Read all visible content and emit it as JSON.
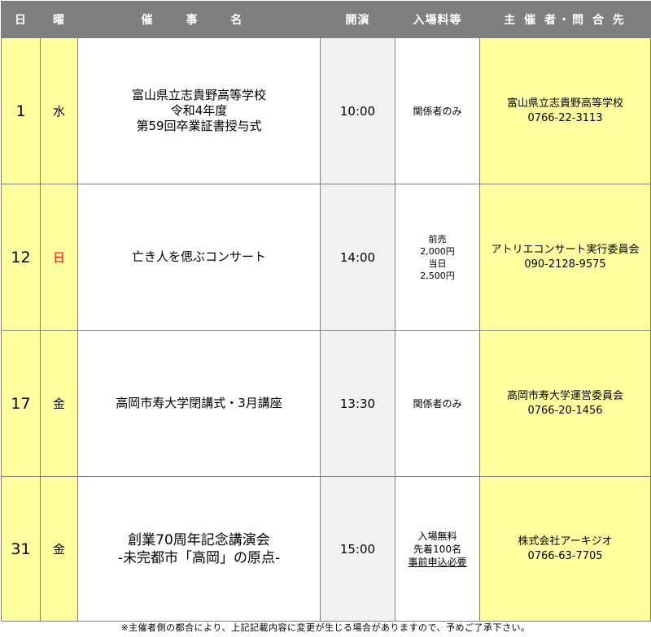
{
  "header": {
    "day": "日",
    "weekday": "曜",
    "event": "催 事 名",
    "start": "開演",
    "fee": "入場料等",
    "organizer": "主 催 者・問 合 先"
  },
  "rows": [
    {
      "day": "1",
      "weekday": "水",
      "title": [
        "富山県立志貴野高等学校",
        "令和4年度",
        "第59回卒業証書授与式"
      ],
      "time": "10:00",
      "fee": [
        "関係者のみ"
      ],
      "org_name": "富山県立志貴野高等学校",
      "org_phone": "0766-22-3113"
    },
    {
      "day": "12",
      "weekday": "日",
      "title": [
        "亡き人を偲ぶコンサート"
      ],
      "time": "14:00",
      "fee": [
        "前売",
        "2,000円",
        "当日",
        "2,500円"
      ],
      "org_name": "アトリエコンサート実行委員会",
      "org_phone": "090-2128-9575"
    },
    {
      "day": "17",
      "weekday": "金",
      "title": [
        "高岡市寿大学閉講式・3月講座"
      ],
      "time": "13:30",
      "fee": [
        "関係者のみ"
      ],
      "org_name": "高岡市寿大学運営委員会",
      "org_phone": "0766-20-1456"
    },
    {
      "day": "31",
      "weekday": "金",
      "title": [
        "創業70周年記念講演会",
        "-未完都市「高岡」の原点-"
      ],
      "time": "15:00",
      "fee": [
        "入場無料",
        "先着100名",
        "事前申込必要"
      ],
      "org_name": "株式会社アーキジオ",
      "org_phone": "0766-63-7705"
    }
  ],
  "footnote": "※主催者側の都合により、上記記載内容に変更が生じる場合がありますので、予めご了承下さい。",
  "colors": {
    "header_bg": "#7f7f7f",
    "yellow": "#ffffa0",
    "sunday": "#ff0000"
  }
}
